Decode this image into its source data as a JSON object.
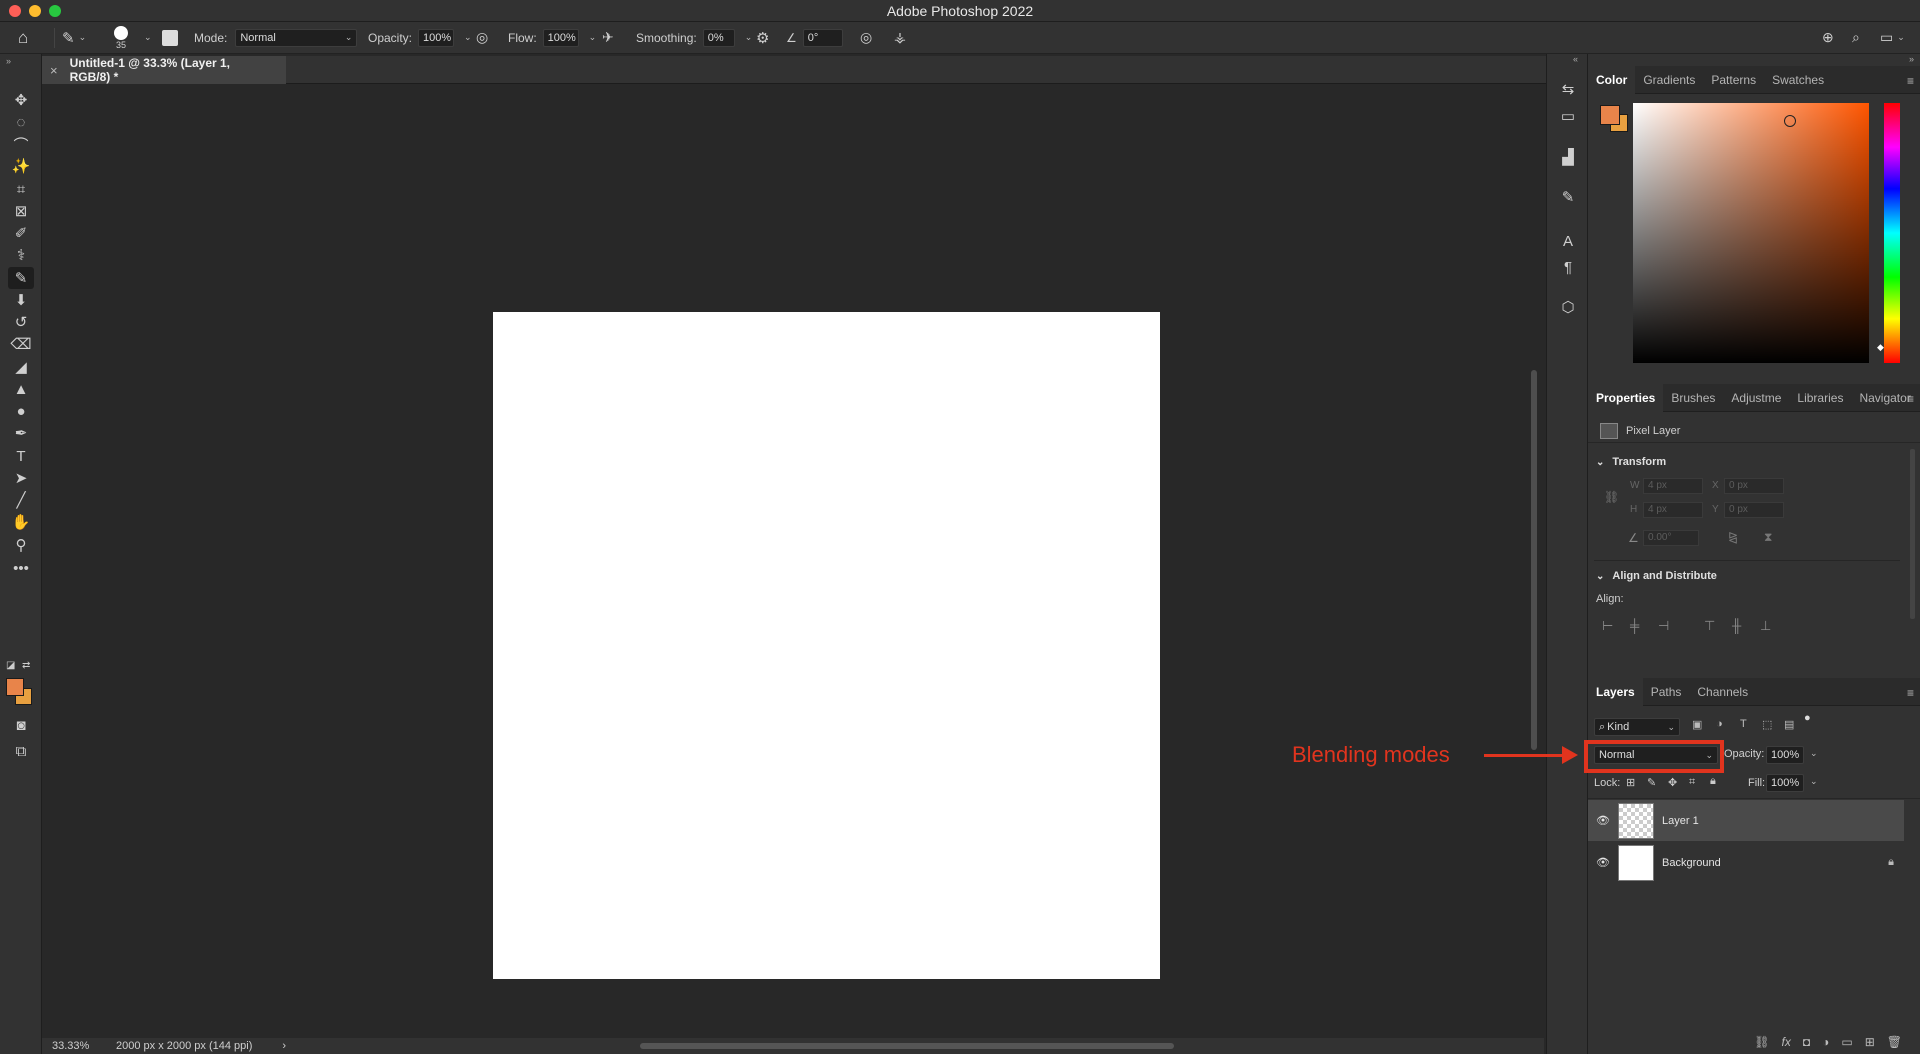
{
  "window": {
    "title": "Adobe Photoshop 2022",
    "traffic_colors": [
      "#fe5f57",
      "#febc2e",
      "#28c840"
    ]
  },
  "options_bar": {
    "brush_size": "35",
    "mode_label": "Mode:",
    "mode_value": "Normal",
    "opacity_label": "Opacity:",
    "opacity_value": "100%",
    "flow_label": "Flow:",
    "flow_value": "100%",
    "smoothing_label": "Smoothing:",
    "smoothing_value": "0%",
    "angle_value": "0°"
  },
  "document": {
    "tab_title": "Untitled-1 @ 33.3% (Layer 1, RGB/8) *",
    "zoom": "33.33%",
    "size_info": "2000 px x 2000 px (144 ppi)",
    "status_arrow": "›"
  },
  "tools": [
    {
      "name": "move-tool-icon",
      "glyph": "✥"
    },
    {
      "name": "marquee-tool-icon",
      "glyph": "◌"
    },
    {
      "name": "lasso-tool-icon",
      "glyph": "⌒"
    },
    {
      "name": "magic-wand-tool-icon",
      "glyph": "✨"
    },
    {
      "name": "crop-tool-icon",
      "glyph": "⌗"
    },
    {
      "name": "frame-tool-icon",
      "glyph": "⊠"
    },
    {
      "name": "eyedropper-tool-icon",
      "glyph": "✐"
    },
    {
      "name": "healing-brush-tool-icon",
      "glyph": "⚕"
    },
    {
      "name": "brush-tool-icon",
      "glyph": "✎"
    },
    {
      "name": "clone-stamp-tool-icon",
      "glyph": "⬇"
    },
    {
      "name": "history-brush-tool-icon",
      "glyph": "↺"
    },
    {
      "name": "eraser-tool-icon",
      "glyph": "⌫"
    },
    {
      "name": "paint-bucket-tool-icon",
      "glyph": "◢"
    },
    {
      "name": "blur-tool-icon",
      "glyph": "▲"
    },
    {
      "name": "dodge-tool-icon",
      "glyph": "●"
    },
    {
      "name": "pen-tool-icon",
      "glyph": "✒"
    },
    {
      "name": "type-tool-icon",
      "glyph": "T"
    },
    {
      "name": "path-selection-tool-icon",
      "glyph": "➤"
    },
    {
      "name": "line-tool-icon",
      "glyph": "╱"
    },
    {
      "name": "hand-tool-icon",
      "glyph": "✋"
    },
    {
      "name": "zoom-tool-icon",
      "glyph": "⚲"
    },
    {
      "name": "more-tools-icon",
      "glyph": "•••"
    }
  ],
  "colors": {
    "foreground": "#e8844a",
    "background": "#e8a040",
    "accent_red": "#e1341e"
  },
  "color_panel": {
    "tabs": [
      "Color",
      "Gradients",
      "Patterns",
      "Swatches"
    ]
  },
  "properties_panel": {
    "tabs": [
      "Properties",
      "Brushes",
      "Adjustme",
      "Libraries",
      "Navigator"
    ],
    "layer_type": "Pixel Layer",
    "transform_title": "Transform",
    "w_label": "W",
    "w_value": "4 px",
    "h_label": "H",
    "h_value": "4 px",
    "x_label": "X",
    "x_value": "0 px",
    "y_label": "Y",
    "y_value": "0 px",
    "angle_value": "0.00°",
    "align_title": "Align and Distribute",
    "align_label": "Align:"
  },
  "layers_panel": {
    "tabs": [
      "Layers",
      "Paths",
      "Channels"
    ],
    "kind_label": "Kind",
    "blend_mode": "Normal",
    "opacity_label": "Opacity:",
    "opacity_value": "100%",
    "lock_label": "Lock:",
    "fill_label": "Fill:",
    "fill_value": "100%",
    "layers": [
      {
        "name": "Layer 1",
        "selected": true
      },
      {
        "name": "Background",
        "selected": false
      }
    ]
  },
  "annotation": {
    "text": "Blending modes"
  }
}
